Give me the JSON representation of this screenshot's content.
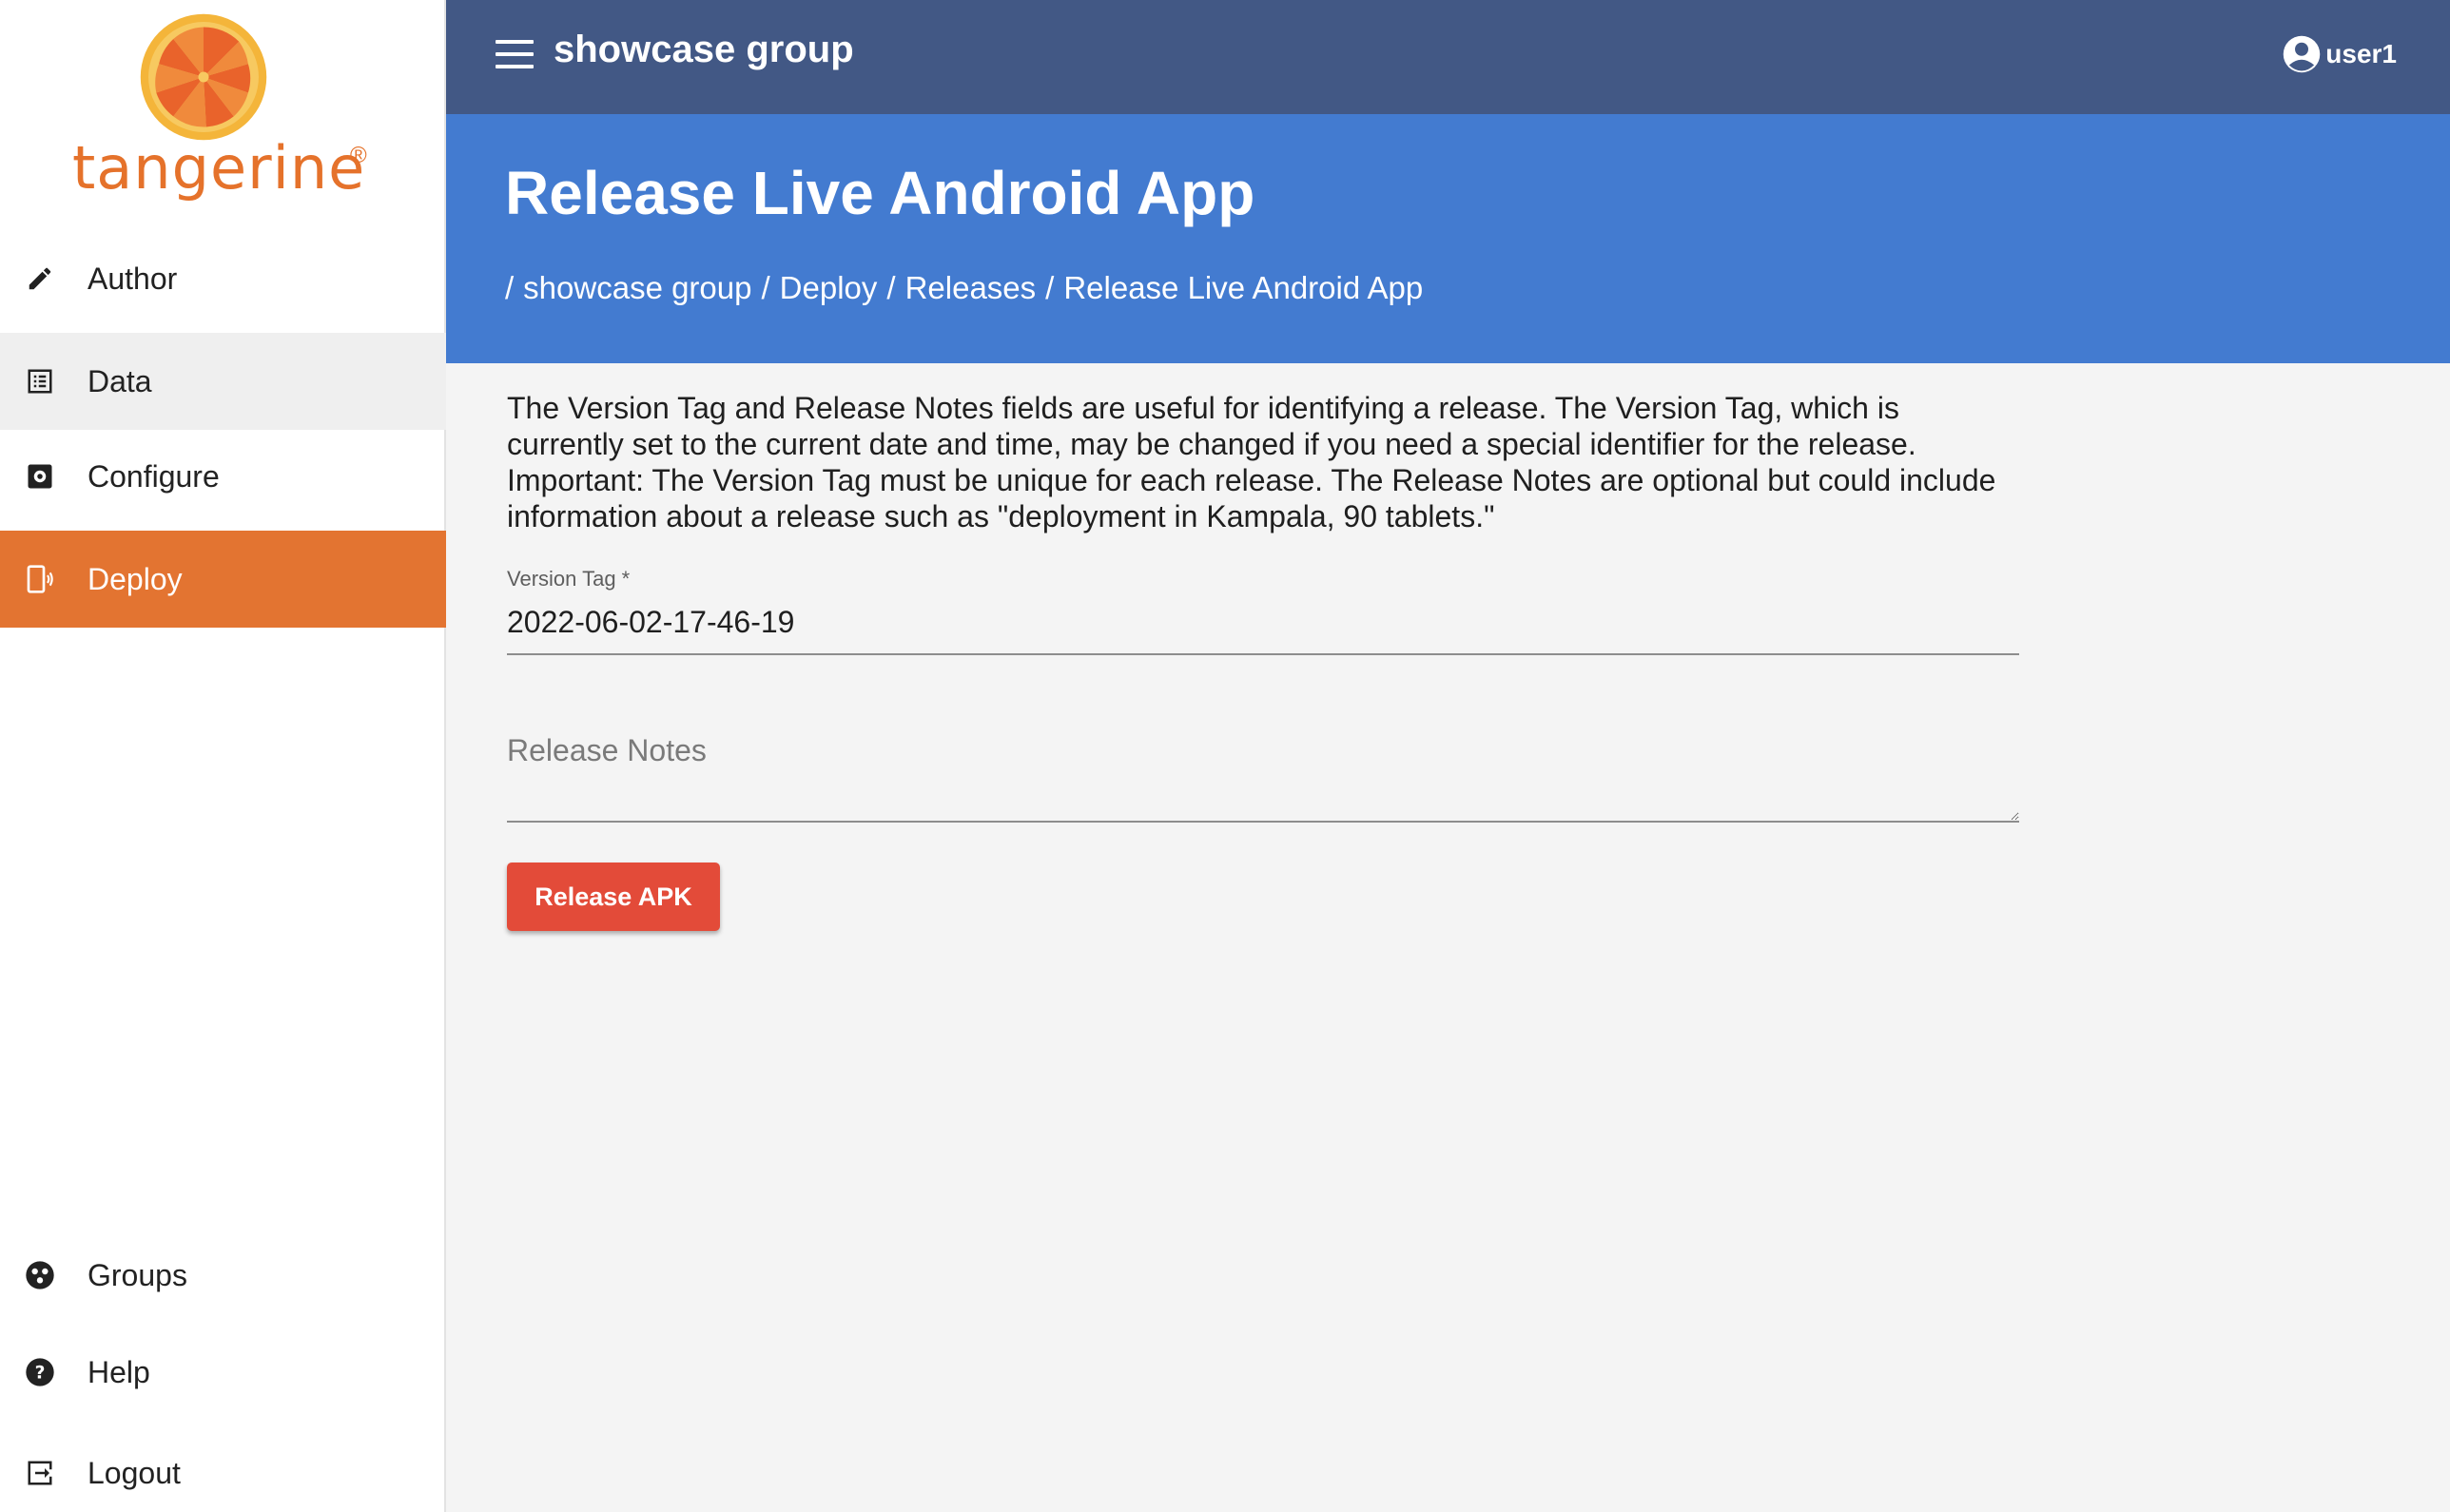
{
  "brand": {
    "name": "tangerine",
    "registered_mark": "®",
    "color": "#e5722b"
  },
  "sidebar": {
    "items": [
      {
        "label": "Author",
        "icon": "pencil-icon"
      },
      {
        "label": "Data",
        "icon": "list-icon"
      },
      {
        "label": "Configure",
        "icon": "settings-icon"
      },
      {
        "label": "Deploy",
        "icon": "phone-deploy-icon"
      }
    ],
    "bottom_items": [
      {
        "label": "Groups",
        "icon": "groups-icon"
      },
      {
        "label": "Help",
        "icon": "help-icon"
      },
      {
        "label": "Logout",
        "icon": "logout-icon"
      }
    ],
    "active_item": "Deploy",
    "active_color": "#e37431"
  },
  "topbar": {
    "group_title": "showcase group",
    "username": "user1",
    "color": "#425885"
  },
  "banner": {
    "title": "Release Live Android App",
    "breadcrumb": [
      "showcase group",
      "Deploy",
      "Releases",
      "Release Live Android App"
    ],
    "color": "#437bd0"
  },
  "content": {
    "intro": "The Version Tag and Release Notes fields are useful for identifying a release. The Version Tag, which is currently set to the current date and time, may be changed if you need a special identifier for the release. Important: The Version Tag must be unique for each release. The Release Notes are optional but could include information about a release such as \"deployment in Kampala, 90 tablets.\"",
    "version_tag": {
      "label": "Version Tag *",
      "value": "2022-06-02-17-46-19"
    },
    "release_notes": {
      "placeholder": "Release Notes",
      "value": ""
    },
    "release_button": {
      "label": "Release APK",
      "color": "#e34b39"
    }
  }
}
